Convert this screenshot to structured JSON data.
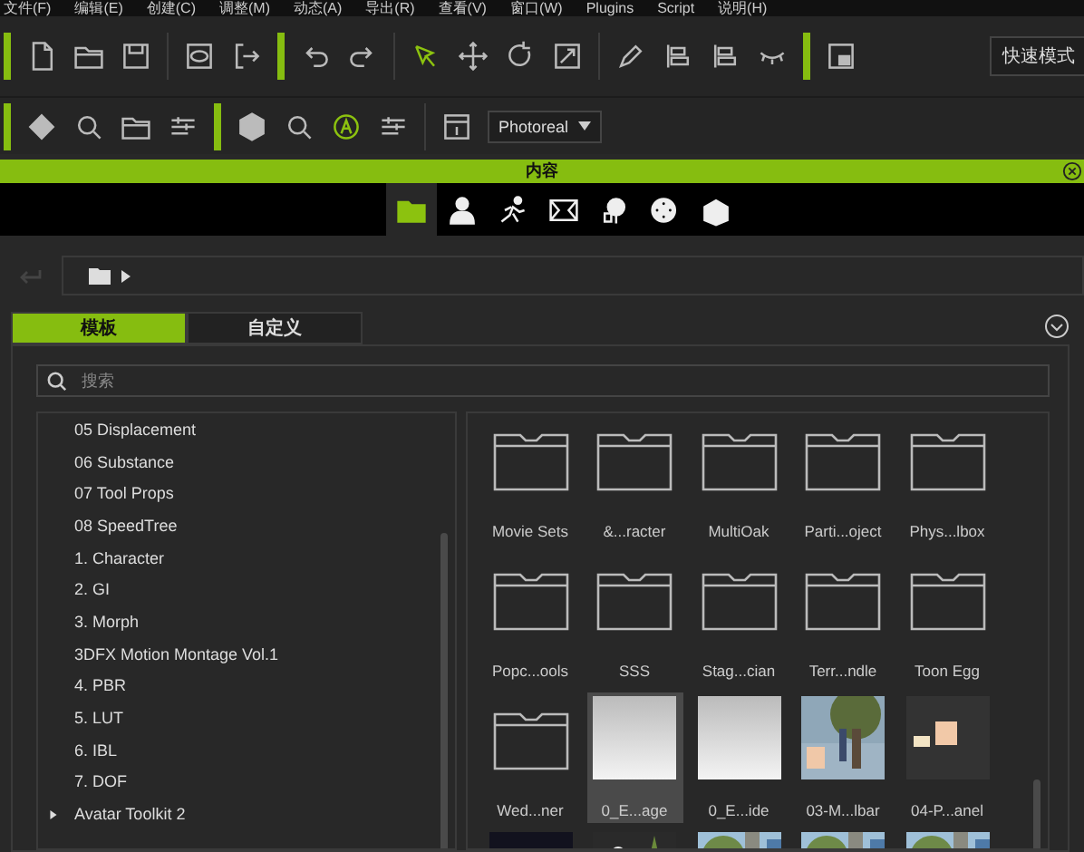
{
  "menu": [
    "文件(F)",
    "编辑(E)",
    "创建(C)",
    "调整(M)",
    "动态(A)",
    "导出(R)",
    "查看(V)",
    "窗口(W)",
    "Plugins",
    "Script",
    "说明(H)"
  ],
  "mode_button": "快速模式",
  "render_dropdown": "Photoreal",
  "panel": {
    "title": "内容"
  },
  "content_tabs": [
    {
      "selected": true
    },
    {
      "selected": false
    },
    {
      "selected": false
    },
    {
      "selected": false
    },
    {
      "selected": false
    },
    {
      "selected": false
    },
    {
      "selected": false
    }
  ],
  "library_tabs": [
    {
      "label": "模板",
      "selected": true
    },
    {
      "label": "自定义",
      "selected": false
    }
  ],
  "search": {
    "placeholder": "搜索"
  },
  "tree": [
    {
      "label": "05 Displacement",
      "kind": "leaf"
    },
    {
      "label": "06 Substance",
      "kind": "leaf"
    },
    {
      "label": "07 Tool Props",
      "kind": "leaf"
    },
    {
      "label": "08 SpeedTree",
      "kind": "leaf"
    },
    {
      "label": "1. Character",
      "kind": "leaf"
    },
    {
      "label": "2. GI",
      "kind": "leaf"
    },
    {
      "label": "3. Morph",
      "kind": "leaf"
    },
    {
      "label": "3DFX Motion Montage Vol.1",
      "kind": "leaf"
    },
    {
      "label": "4. PBR",
      "kind": "leaf"
    },
    {
      "label": "5. LUT",
      "kind": "leaf"
    },
    {
      "label": "6. IBL",
      "kind": "leaf"
    },
    {
      "label": "7. DOF",
      "kind": "leaf"
    },
    {
      "label": "Avatar Toolkit 2",
      "kind": "group",
      "expanded": false
    }
  ],
  "items": [
    {
      "label": "Movie Sets",
      "kind": "folder",
      "selected": false
    },
    {
      "label": "&...racter",
      "kind": "folder",
      "selected": false
    },
    {
      "label": "MultiOak",
      "kind": "folder",
      "selected": false
    },
    {
      "label": "Parti...oject",
      "kind": "folder",
      "selected": false
    },
    {
      "label": "Phys...lbox",
      "kind": "folder",
      "selected": false
    },
    {
      "label": "Popc...ools",
      "kind": "folder",
      "selected": false
    },
    {
      "label": "SSS",
      "kind": "folder",
      "selected": false
    },
    {
      "label": "Stag...cian",
      "kind": "folder",
      "selected": false
    },
    {
      "label": "Terr...ndle",
      "kind": "folder",
      "selected": false
    },
    {
      "label": "Toon Egg",
      "kind": "folder",
      "selected": false
    },
    {
      "label": "Wed...ner",
      "kind": "folder",
      "selected": false
    },
    {
      "label": "0_E...age",
      "kind": "gradient",
      "selected": true
    },
    {
      "label": "0_E...ide",
      "kind": "gradient",
      "selected": false
    },
    {
      "label": "03-M...lbar",
      "kind": "picture",
      "selected": false
    },
    {
      "label": "04-P...anel",
      "kind": "boxes",
      "selected": false
    }
  ]
}
